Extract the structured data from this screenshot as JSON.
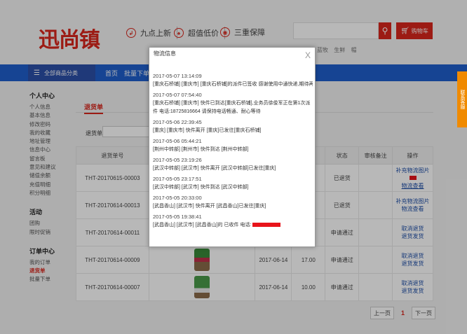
{
  "header": {
    "logo_text": "迅尚镇",
    "promos": [
      {
        "icon": "clock-icon",
        "glyph": "↲",
        "label": "九点上新"
      },
      {
        "icon": "price-icon",
        "glyph": "♠",
        "label": "超值低价"
      },
      {
        "icon": "shield-icon",
        "glyph": "◉",
        "label": "三重保障"
      }
    ],
    "search_placeholder": "",
    "cart_label": "购物车",
    "hotwords": [
      "蓝牧",
      "生鲜",
      "帽"
    ]
  },
  "nav": {
    "category_label": "全部商品分类",
    "links": [
      "首页",
      "批量下单"
    ]
  },
  "sidebar": {
    "groups": [
      {
        "head": "个人中心",
        "items": [
          "个人信息",
          "基本信息",
          "修改密码",
          "我的收藏",
          "地址管理",
          "信息中心",
          "留言板",
          "意见和建议",
          "储值余额",
          "充值明细",
          "积分明细"
        ]
      },
      {
        "head": "活动",
        "items": [
          "团购",
          "限时促销"
        ]
      },
      {
        "head": "订单中心",
        "items": [
          "我的订单",
          "退货单",
          "批量下单"
        ]
      }
    ],
    "active_item": "退货单"
  },
  "main": {
    "tab_label": "退货单",
    "filter_label": "退货单号",
    "columns": [
      "退货单号",
      "",
      "",
      "",
      "状态",
      "审核备注",
      "操作"
    ],
    "rows": [
      {
        "id": "THT-20170615-00003",
        "date": "",
        "amount": "",
        "status": "已退货",
        "note": "",
        "ops": [
          "补充物流图片",
          "物流查看"
        ]
      },
      {
        "id": "THT-20170614-00013",
        "date": "",
        "amount": "",
        "status": "已退货",
        "note": "",
        "ops": [
          "补充物流图片",
          "物流查看"
        ]
      },
      {
        "id": "THT-20170614-00011",
        "date": "",
        "amount": "",
        "status": "申请通过",
        "note": "",
        "ops": [
          "取消退货",
          "退货发货"
        ]
      },
      {
        "id": "THT-20170614-00009",
        "date": "2017-06-14",
        "amount": "17.00",
        "status": "申请通过",
        "note": "",
        "ops": [
          "取消退货",
          "退货发货"
        ]
      },
      {
        "id": "THT-20170614-00007",
        "date": "2017-06-14",
        "amount": "10.00",
        "status": "申请通过",
        "note": "",
        "ops": [
          "取消退货",
          "退货发货"
        ]
      }
    ],
    "pager": {
      "prev": "上一页",
      "current": "1",
      "next": "下一页"
    }
  },
  "service_tab": {
    "label": "联系客服"
  },
  "modal": {
    "title": "物流信息",
    "close_glyph": "X",
    "logs": [
      {
        "time": "2017-05-07 13:14:09",
        "text": "[重庆石桥铺] [重庆市] [重庆石桥铺]的派件已签收 感谢使用中通快递,期待再次为您服务!"
      },
      {
        "time": "2017-05-07 07:54:40",
        "text": "[重庆石桥铺] [重庆市] 快件已到达[重庆石桥铺],业务员徐俊军正在第1次派件 电话:18725816664 请保持电话畅通、耐心等待"
      },
      {
        "time": "2017-05-06 22:39:45",
        "text": "[重庆] [重庆市] 快件离开 [重庆]已发往[重庆石桥铺]"
      },
      {
        "time": "2017-05-06 05:44:21",
        "text": "[荆州中转部] [荆州市] 快件到达 [荆州中转部]"
      },
      {
        "time": "2017-05-05 23:19:26",
        "text": "[武汉中转部] [武汉市] 快件离开 [武汉中转部]已发往[重庆]"
      },
      {
        "time": "2017-05-05 23:17:51",
        "text": "[武汉中转部] [武汉市] 快件到达 [武汉中转部]"
      },
      {
        "time": "2017-05-05 20:33:00",
        "text": "[武昌香山] [武汉市] 快件离开 [武昌香山]已发往[重庆]"
      },
      {
        "time": "2017-05-05 19:38:41",
        "text": "[武昌香山] [武汉市] [武昌香山]的 已收件 电话:"
      }
    ]
  },
  "colors": {
    "brand_red": "#d9261c",
    "nav_blue": "#1f5fcc",
    "link_blue": "#1f4fa8",
    "redact_red": "#e8141b",
    "service_orange": "#f08a00"
  }
}
